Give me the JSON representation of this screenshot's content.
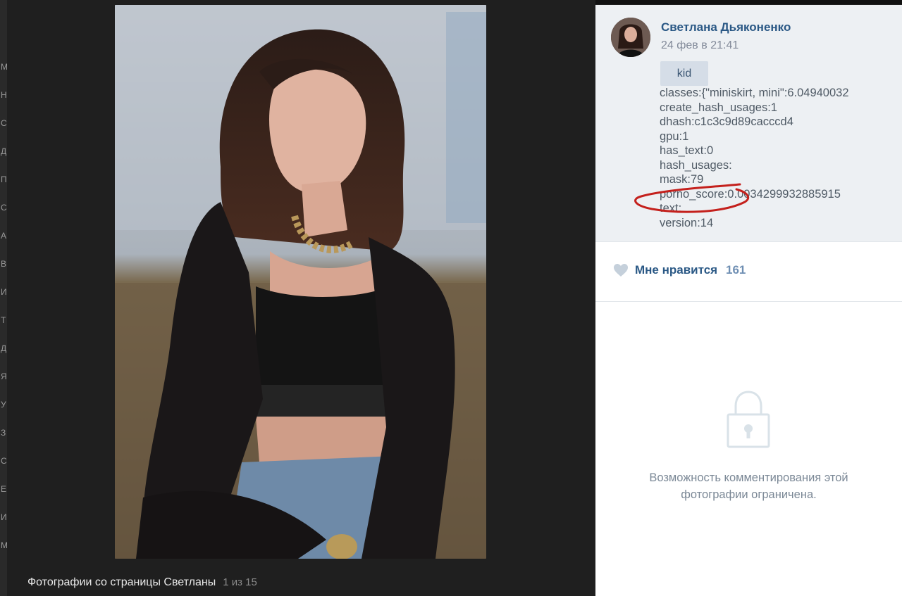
{
  "background_page": {
    "letters": [
      "М",
      "Н",
      "С",
      "Д",
      "П",
      "С",
      "А",
      "В",
      "И",
      "Т",
      "Д",
      "Я",
      "У",
      "З",
      "С",
      "Е",
      "И",
      "М"
    ]
  },
  "viewer": {
    "caption": "Фотографии со страницы Светланы",
    "counter": "1 из 15"
  },
  "post": {
    "author_name": "Светлана Дьяконенко",
    "date": "24 фев в 21:41",
    "tag": "kid",
    "meta_lines": [
      "classes:{\"miniskirt, mini\":6.04940032",
      "create_hash_usages:1",
      "dhash:c1c3c9d89cacccd4",
      "gpu:1",
      "has_text:0",
      "hash_usages:",
      "mask:79",
      "porno_score:0.0034299932885915",
      "text:",
      "version:14"
    ]
  },
  "likes": {
    "label": "Мне нравится",
    "count": "161"
  },
  "comments": {
    "note": "Возможность комментирования этой фотографии ограничена."
  },
  "icons": {
    "heart": "heart-icon",
    "lock": "lock-icon"
  },
  "colors": {
    "link": "#2a5885",
    "annotation": "#c4201c",
    "panel": "#edf0f3"
  }
}
